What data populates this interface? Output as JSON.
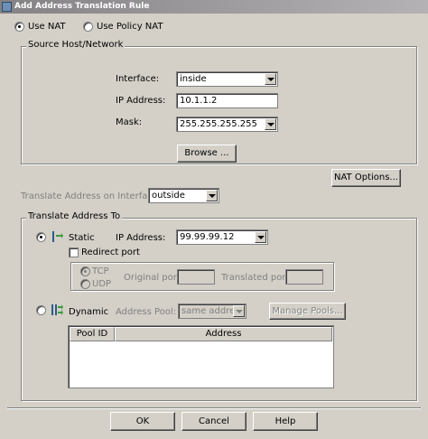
{
  "window": {
    "title": "Add Address Translation Rule"
  },
  "nat_mode": {
    "use_nat": "Use NAT",
    "use_policy_nat": "Use Policy NAT"
  },
  "source": {
    "group_label": "Source Host/Network",
    "interface_label": "Interface:",
    "interface_value": "inside",
    "ip_label": "IP Address:",
    "ip_value": "10.1.1.2",
    "mask_label": "Mask:",
    "mask_value": "255.255.255.255",
    "browse": "Browse ..."
  },
  "nat_options": "NAT Options...",
  "translate_iface": {
    "label": "Translate Address on Interface:",
    "value": "outside"
  },
  "translate_to": {
    "group_label": "Translate Address To",
    "static": {
      "label": "Static",
      "ip_label": "IP Address:",
      "ip_value": "99.99.99.12",
      "redirect_port": "Redirect port",
      "tcp": "TCP",
      "udp": "UDP",
      "original_port": "Original port:",
      "translated_port": "Translated port:"
    },
    "dynamic": {
      "label": "Dynamic",
      "pool_label": "Address Pool:",
      "pool_value": "same address",
      "manage_pools": "Manage Pools..."
    },
    "table": {
      "columns": [
        "Pool ID",
        "Address"
      ]
    }
  },
  "footer": {
    "ok": "OK",
    "cancel": "Cancel",
    "help": "Help"
  }
}
